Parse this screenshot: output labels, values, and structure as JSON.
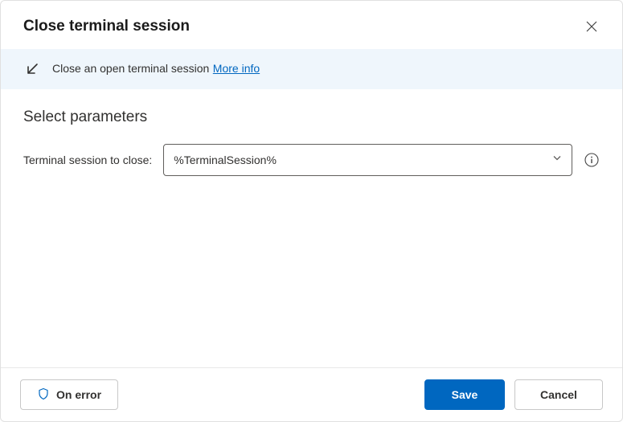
{
  "header": {
    "title": "Close terminal session"
  },
  "banner": {
    "description": "Close an open terminal session",
    "moreInfoLabel": "More info"
  },
  "body": {
    "sectionTitle": "Select parameters",
    "param": {
      "label": "Terminal session to close:",
      "value": "%TerminalSession%"
    }
  },
  "footer": {
    "onErrorLabel": "On error",
    "saveLabel": "Save",
    "cancelLabel": "Cancel"
  }
}
